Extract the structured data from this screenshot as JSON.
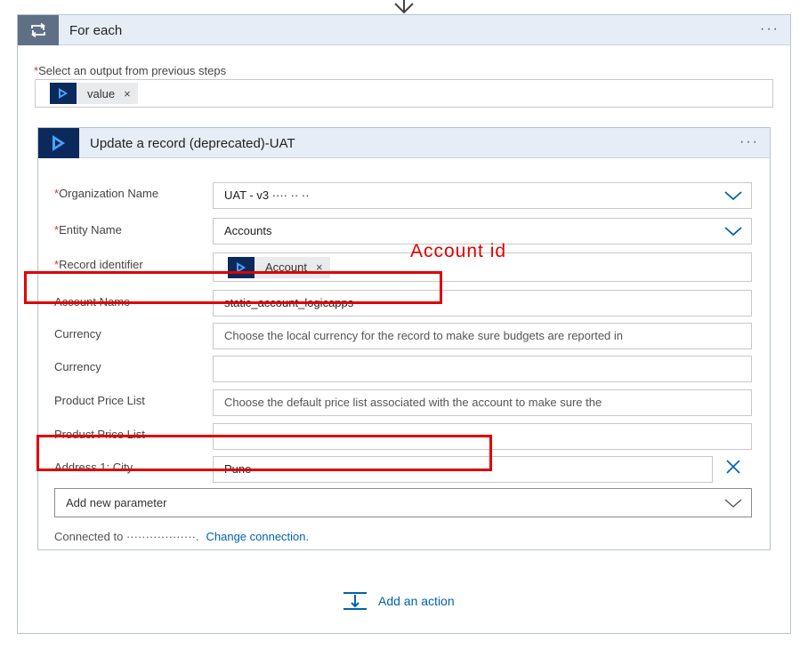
{
  "arrow_icon": "arrow-down-icon",
  "foreach": {
    "title": "For each",
    "menu_label": "···",
    "icon": "loop-icon",
    "select_label": "Select an output from previous steps",
    "required_marker": "*",
    "output_token": {
      "label": "value",
      "remove": "×",
      "icon": "dynamics-icon"
    }
  },
  "action": {
    "title": "Update a record (deprecated)-UAT",
    "menu_label": "···",
    "icon": "dynamics-icon",
    "fields": {
      "org": {
        "required": "*",
        "label": "Organization Name",
        "value": "UAT - v3 ···· ·· ··"
      },
      "entity": {
        "required": "*",
        "label": "Entity Name",
        "value": "Accounts"
      },
      "record": {
        "required": "*",
        "label": "Record identifier",
        "token_label": "Account",
        "token_remove": "×"
      },
      "account_name": {
        "label": "Account Name",
        "value": "static_account_logicapps"
      },
      "currency1": {
        "label": "Currency",
        "placeholder": "Choose the local currency for the record to make sure budgets are reported in"
      },
      "currency2": {
        "label": "Currency",
        "placeholder": ""
      },
      "price_list1": {
        "label": "Product Price List",
        "placeholder": "Choose the default price list associated with the account to make sure the"
      },
      "price_list2": {
        "label": "Product Price List",
        "placeholder": ""
      },
      "city": {
        "label": "Address 1: City",
        "value": "Pune"
      }
    },
    "add_parameter": "Add new parameter",
    "connected_to": "Connected to ··················.",
    "change_connection": "Change connection."
  },
  "annotation": {
    "text": "Account id",
    "color": "#e00000"
  },
  "add_action": {
    "label": "Add an action",
    "icon": "insert-step-icon"
  },
  "colors": {
    "header_bg": "#e6edf6",
    "dynamics_navy": "#0b2a5b",
    "link_blue": "#0062ad",
    "required_red": "#d13438"
  }
}
